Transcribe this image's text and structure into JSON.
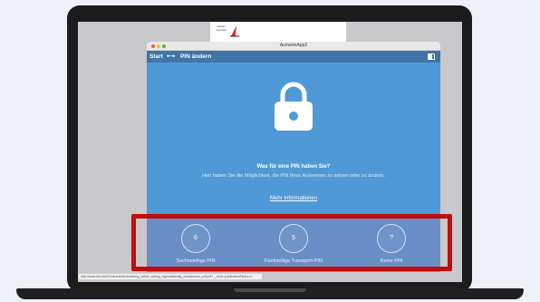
{
  "window": {
    "title": "AusweisApp2"
  },
  "document": {
    "logo_text_line1": "nebelin",
    "logo_text_line2": "bucchlin"
  },
  "navbar": {
    "start_label": "Start",
    "arrow": "⟷",
    "page_label": "PIN ändern",
    "menu_icon": "help-panel-icon"
  },
  "content": {
    "icon": "lock-icon",
    "question": "Was für eine PIN haben Sie?",
    "description": "Hier haben Sie die Möglichkeit, die PIN Ihres Ausweises zu setzen oder zu ändern.",
    "more_link": "Mehr Informationen"
  },
  "choices": [
    {
      "value": "6",
      "label": "Sechsstellige PIN"
    },
    {
      "value": "5",
      "label": "Fünfstellige Transport-PIN"
    },
    {
      "value": "?",
      "label": "Keine PIN"
    }
  ],
  "statusbar": {
    "url": "http://www.elio.de/0/Dokumente/anleitung_online_antrag_eigenstaendig_smartphone_pdf.pdf?__blob=publicationFile&v=2"
  },
  "colors": {
    "content_bg": "#4f9ad6",
    "navbar_bg": "#3f74a8",
    "choice_bar_bg": "#6a8fc6",
    "highlight": "#c00d0d"
  }
}
